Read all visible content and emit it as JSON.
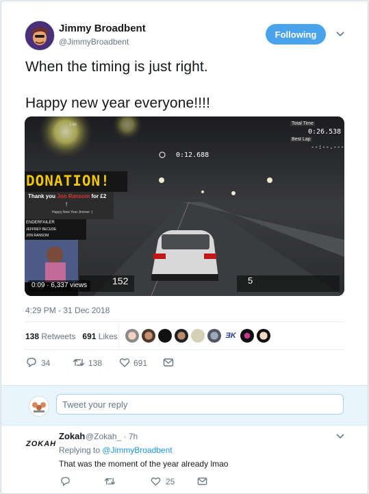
{
  "author": {
    "name": "Jimmy Broadbent",
    "handle": "@JimmyBroadbent",
    "follow_label": "Following"
  },
  "tweet": {
    "line1": "When the timing is just right.",
    "line2": "Happy new year everyone!!!!",
    "timestamp": "4:29 PM - 31 Dec 2018",
    "retweets_count": "138",
    "retweets_label": "Retweets",
    "likes_count": "691",
    "likes_label": "Likes"
  },
  "media": {
    "lap_label": "Lap",
    "total_time_label": "Total Time",
    "total_time": "0:26.538",
    "best_lap_label": "Best Lap",
    "best_lap": "--:--.---",
    "current_time": "0:12.688",
    "donation_title": "DONATION!",
    "donation_text_a": "Thank you",
    "donation_name": "Jon Ransom",
    "donation_text_b": "for £2",
    "donation_bang": "!",
    "donation_message": "Happy New Year Jimmer :)",
    "chat_names": [
      "ENDERFAILER",
      "JEFFREY BECUDE",
      "JON RANSOM"
    ],
    "video_time": "0:09",
    "views": "6,337 views",
    "speed": "152",
    "gear": "5"
  },
  "actions": {
    "reply_count": "34",
    "retweet_count": "138",
    "like_count": "691"
  },
  "reply_box": {
    "placeholder": "Tweet your reply"
  },
  "reply": {
    "logo": "ZOKAH",
    "name": "Zokah",
    "handle": "@Zokah_ · 7h",
    "replying_to_prefix": "Replying to",
    "replying_to": "@JimmyBroadbent",
    "text": "That was the moment of the year already lmao",
    "like_count": "25"
  },
  "colors": {
    "accent": "#1da1f2",
    "follow_bg": "#4ba3eb",
    "donation_yellow": "#f2c600"
  }
}
